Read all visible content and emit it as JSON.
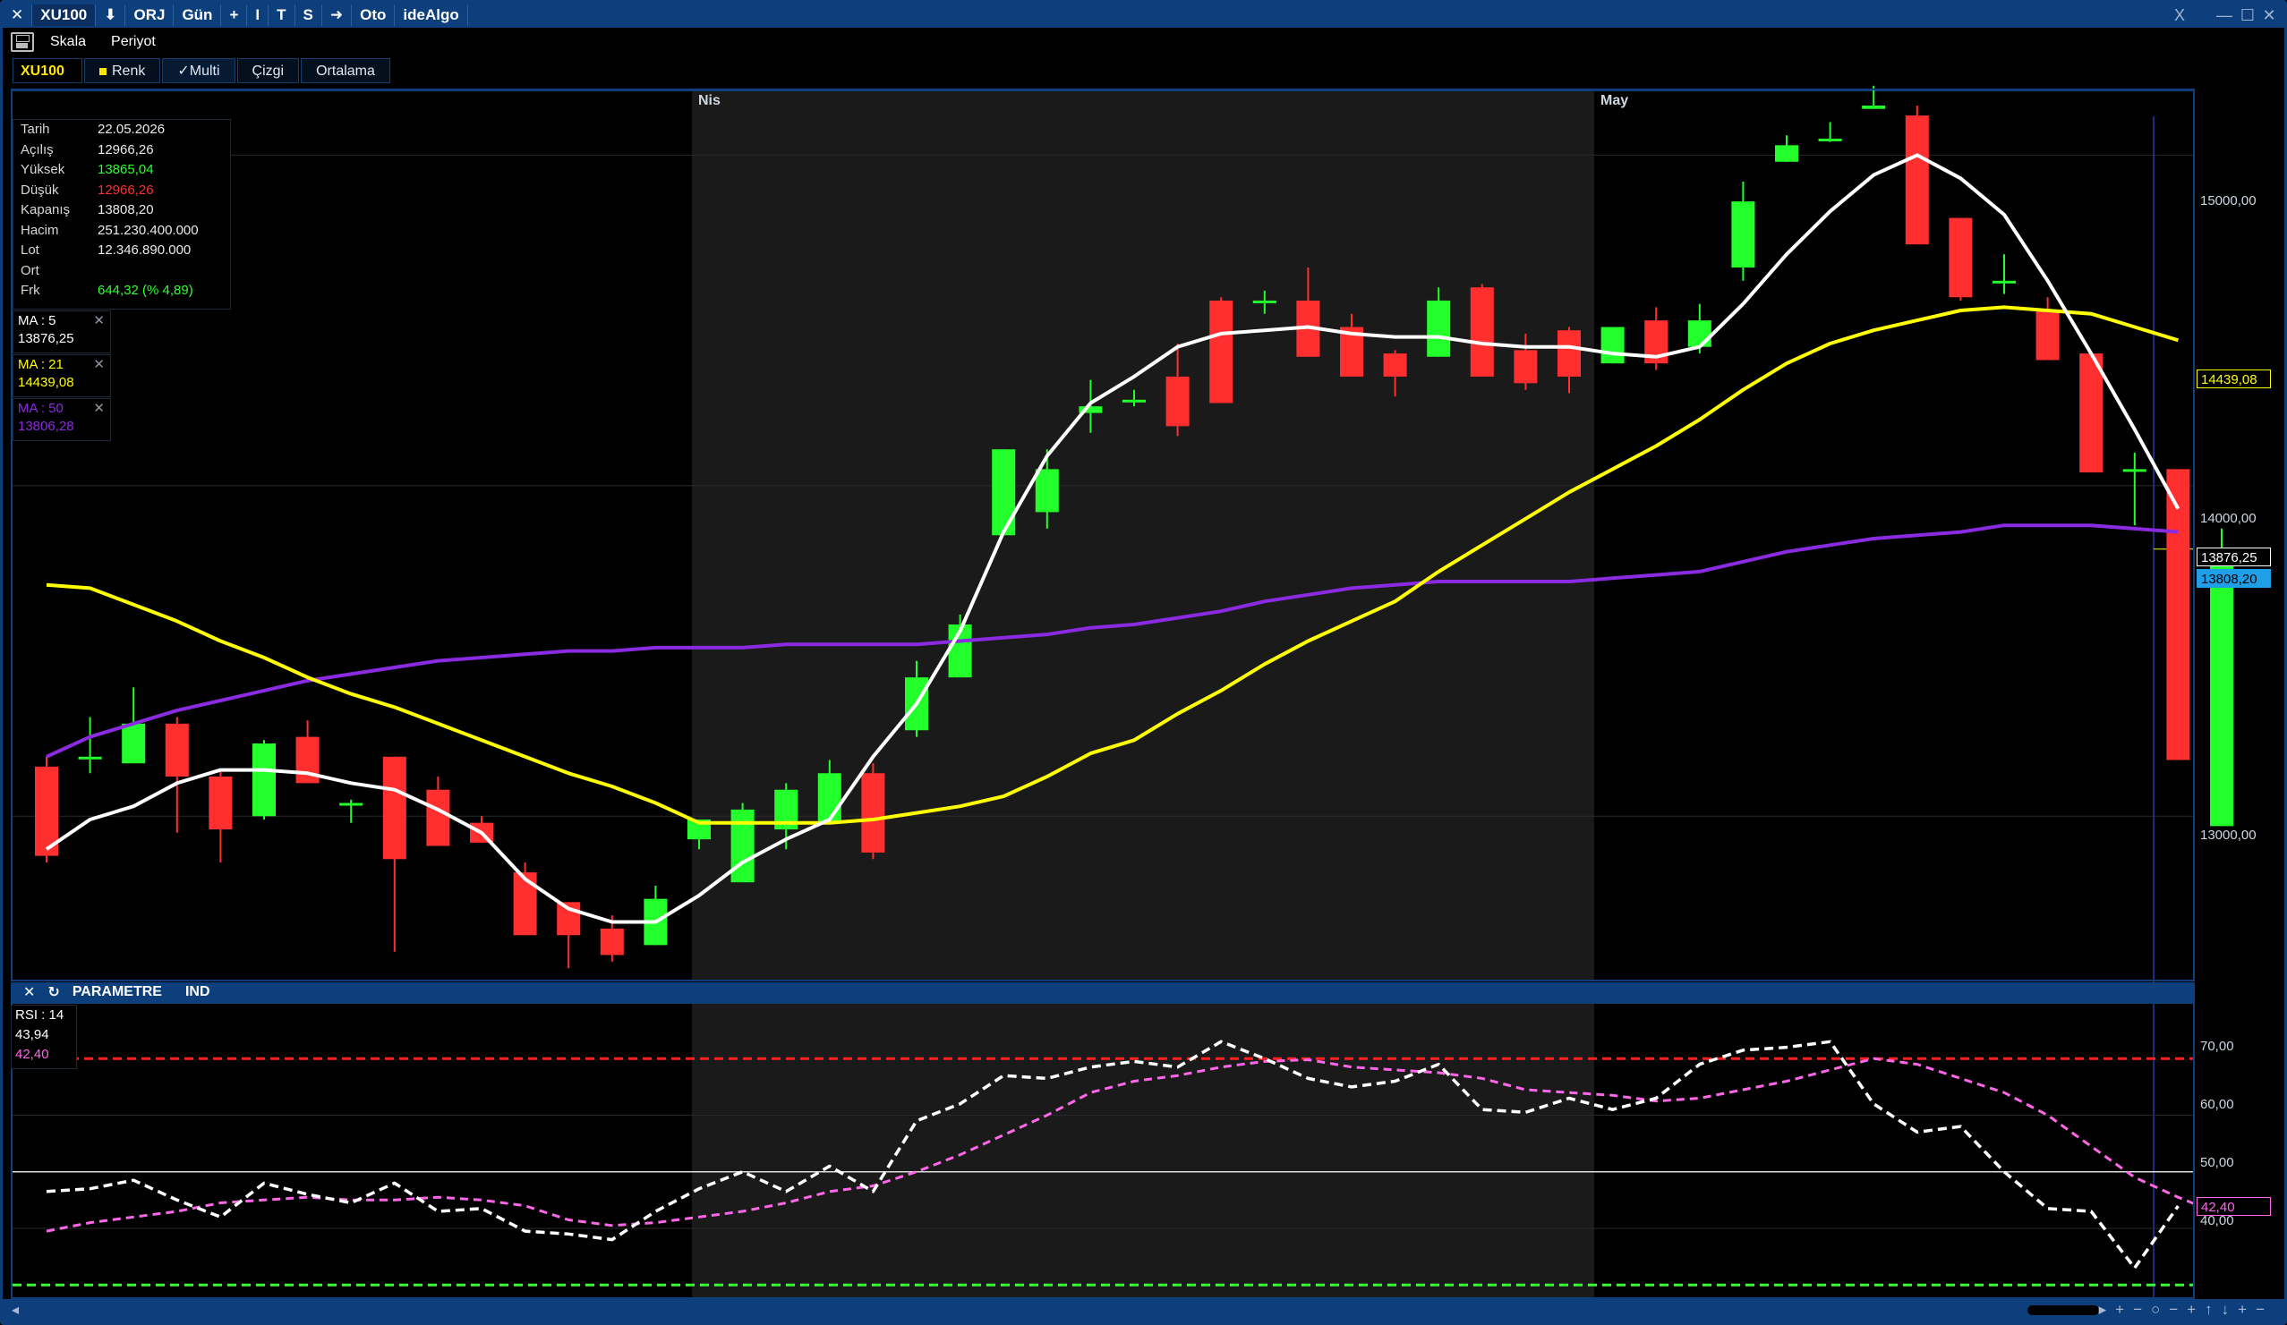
{
  "titlebar": {
    "items": [
      {
        "name": "close-icon",
        "label": "✕"
      },
      {
        "name": "symbol-label",
        "label": "XU100"
      },
      {
        "name": "download-icon",
        "label": "⬇"
      },
      {
        "name": "orj-button",
        "label": "ORJ"
      },
      {
        "name": "period-button",
        "label": "Gün"
      },
      {
        "name": "plus-icon",
        "label": "+"
      },
      {
        "name": "vertical-line-icon",
        "label": "I"
      },
      {
        "name": "t-button",
        "label": "T"
      },
      {
        "name": "s-button",
        "label": "S"
      },
      {
        "name": "arrow-right-icon",
        "label": "➜"
      },
      {
        "name": "oto-button",
        "label": "Oto"
      },
      {
        "name": "idealgo-button",
        "label": "ideAlgo"
      }
    ],
    "window_controls": [
      "X",
      "—",
      "☐",
      "✕"
    ]
  },
  "toolbar": {
    "scale": "Skala",
    "period": "Periyot"
  },
  "tabs": {
    "symbol": "XU100",
    "color": "Renk",
    "multi": "✓Multi",
    "line": "Çizgi",
    "average": "Ortalama"
  },
  "months": [
    "Nis",
    "May"
  ],
  "ohlc": [
    {
      "k": "Tarih",
      "v": "22.05.2026",
      "color": "#eaeaea"
    },
    {
      "k": "Açılış",
      "v": "12966,26",
      "color": "#eaeaea"
    },
    {
      "k": "Yüksek",
      "v": "13865,04",
      "color": "#2dff2d"
    },
    {
      "k": "Düşük",
      "v": "12966,26",
      "color": "#ff3030"
    },
    {
      "k": "Kapanış",
      "v": "13808,20",
      "color": "#eaeaea"
    },
    {
      "k": "Hacim",
      "v": "251.230.400.000",
      "color": "#eaeaea"
    },
    {
      "k": "Lot",
      "v": "12.346.890.000",
      "color": "#eaeaea"
    },
    {
      "k": "Ort",
      "v": "",
      "color": "#eaeaea"
    },
    {
      "k": "Frk",
      "v": "644,32 (% 4,89)",
      "color": "#2dff2d"
    }
  ],
  "ma": [
    {
      "label": "MA : 5",
      "value": "13876,25",
      "color": "#ffffff"
    },
    {
      "label": "MA : 21",
      "value": "14439,08",
      "color": "#ffff00"
    },
    {
      "label": "MA : 50",
      "value": "13806,28",
      "color": "#8a2be2"
    }
  ],
  "price_axis": [
    "15000,00",
    "14000,00",
    "13000,00"
  ],
  "price_tags": [
    {
      "value": "14439,08",
      "bg": "#000",
      "color": "#ffff00",
      "border": "#ffff00"
    },
    {
      "value": "13876,25",
      "bg": "#000",
      "color": "#ffffff",
      "border": "#ffffff"
    },
    {
      "value": "13808,20",
      "bg": "#1f9fe8",
      "color": "#000",
      "border": "#1f9fe8"
    }
  ],
  "indicator_bar": {
    "params": "PARAMETRE",
    "ind": "IND"
  },
  "rsi": {
    "label": "RSI : 14",
    "value": "43,94",
    "signal": "42,40"
  },
  "rsi_axis": [
    "70,00",
    "60,00",
    "50,00",
    "40,00"
  ],
  "rsi_tag": "42,40",
  "colors": {
    "up": "#23ff2a",
    "down": "#ff2f2f",
    "ma5": "#ffffff",
    "ma21": "#ffff00",
    "ma50": "#8a2be2",
    "rsi": "#ffffff",
    "rsi_signal": "#ff66e8",
    "brand": "#0d3f7d"
  },
  "chart_data": {
    "type": "candlestick",
    "y_range": [
      12500,
      15150
    ],
    "candles": [
      [
        13150,
        12880,
        13180,
        12860
      ],
      [
        13180,
        13180,
        13300,
        13130
      ],
      [
        13160,
        13280,
        13390,
        13160
      ],
      [
        13280,
        13120,
        13300,
        12950
      ],
      [
        13120,
        12960,
        13140,
        12860
      ],
      [
        13000,
        13220,
        13230,
        12990
      ],
      [
        13240,
        13100,
        13290,
        13100
      ],
      [
        13040,
        13040,
        13050,
        12980
      ],
      [
        13180,
        12870,
        13180,
        12590
      ],
      [
        13080,
        12910,
        13120,
        12910
      ],
      [
        12980,
        12920,
        13000,
        12920
      ],
      [
        12830,
        12640,
        12860,
        12640
      ],
      [
        12740,
        12640,
        12740,
        12540
      ],
      [
        12660,
        12580,
        12700,
        12560
      ],
      [
        12610,
        12750,
        12790,
        12610
      ],
      [
        12930,
        12990,
        12990,
        12900
      ],
      [
        12800,
        13020,
        13040,
        12800
      ],
      [
        12960,
        13080,
        13100,
        12900
      ],
      [
        12980,
        13130,
        13170,
        12980
      ],
      [
        13130,
        12890,
        13160,
        12870
      ],
      [
        13260,
        13420,
        13470,
        13240
      ],
      [
        13420,
        13580,
        13610,
        13420
      ],
      [
        13850,
        14110,
        14110,
        13850
      ],
      [
        13920,
        14050,
        14110,
        13870
      ],
      [
        14220,
        14240,
        14320,
        14160
      ],
      [
        14260,
        14260,
        14290,
        14240
      ],
      [
        14330,
        14180,
        14430,
        14150
      ],
      [
        14560,
        14250,
        14570,
        14250
      ],
      [
        14560,
        14560,
        14590,
        14520
      ],
      [
        14560,
        14390,
        14660,
        14390
      ],
      [
        14480,
        14330,
        14520,
        14330
      ],
      [
        14400,
        14330,
        14410,
        14270
      ],
      [
        14390,
        14560,
        14600,
        14390
      ],
      [
        14600,
        14330,
        14610,
        14330
      ],
      [
        14410,
        14310,
        14460,
        14290
      ],
      [
        14470,
        14330,
        14480,
        14280
      ],
      [
        14370,
        14480,
        14480,
        14370
      ],
      [
        14500,
        14370,
        14540,
        14350
      ],
      [
        14420,
        14500,
        14550,
        14400
      ],
      [
        14660,
        14860,
        14920,
        14620
      ],
      [
        14980,
        15030,
        15060,
        14980
      ],
      [
        15050,
        15050,
        15100,
        15040
      ],
      [
        15140,
        15150,
        15210,
        15140
      ],
      [
        15120,
        14730,
        15150,
        14730
      ],
      [
        14810,
        14570,
        14810,
        14560
      ],
      [
        14620,
        14620,
        14700,
        14580
      ],
      [
        14530,
        14380,
        14570,
        14380
      ],
      [
        14400,
        14040,
        14400,
        14040
      ],
      [
        14050,
        14050,
        14100,
        13880
      ],
      [
        14050,
        13170,
        14050,
        13170
      ],
      [
        12970,
        13810,
        13870,
        12970
      ]
    ],
    "ma5": [
      12900,
      12990,
      13030,
      13100,
      13140,
      13140,
      13130,
      13100,
      13080,
      13020,
      12950,
      12810,
      12720,
      12680,
      12680,
      12760,
      12860,
      12930,
      12990,
      13180,
      13340,
      13560,
      13860,
      14090,
      14250,
      14330,
      14420,
      14460,
      14470,
      14480,
      14460,
      14450,
      14450,
      14430,
      14420,
      14420,
      14400,
      14390,
      14420,
      14550,
      14700,
      14830,
      14940,
      15000,
      14930,
      14820,
      14620,
      14400,
      14170,
      13930
    ],
    "ma21": [
      13700,
      13690,
      13640,
      13590,
      13530,
      13480,
      13420,
      13370,
      13330,
      13280,
      13230,
      13180,
      13130,
      13090,
      13040,
      12980,
      12980,
      12980,
      12980,
      12990,
      13010,
      13030,
      13060,
      13120,
      13190,
      13230,
      13310,
      13380,
      13460,
      13530,
      13590,
      13650,
      13740,
      13820,
      13900,
      13980,
      14050,
      14120,
      14200,
      14290,
      14370,
      14430,
      14470,
      14500,
      14530,
      14540,
      14530,
      14520,
      14480,
      14440
    ],
    "ma50": [
      13180,
      13240,
      13280,
      13320,
      13350,
      13380,
      13410,
      13430,
      13450,
      13470,
      13480,
      13490,
      13500,
      13500,
      13510,
      13510,
      13510,
      13520,
      13520,
      13520,
      13520,
      13530,
      13540,
      13550,
      13570,
      13580,
      13600,
      13620,
      13650,
      13670,
      13690,
      13700,
      13710,
      13710,
      13710,
      13710,
      13720,
      13730,
      13740,
      13770,
      13800,
      13820,
      13840,
      13850,
      13860,
      13880,
      13880,
      13880,
      13870,
      13860
    ],
    "rsi": [
      46.5,
      47,
      48.5,
      45,
      42,
      48,
      46,
      44.5,
      48,
      43,
      43.5,
      39.5,
      39,
      38,
      43,
      47,
      50,
      46.5,
      51,
      46.5,
      59,
      62,
      67,
      66.5,
      68.5,
      69.5,
      68.5,
      73,
      70,
      66.5,
      65,
      66,
      69,
      61,
      60.5,
      63,
      61,
      63,
      69,
      71.5,
      72,
      73,
      62,
      57,
      58,
      50,
      43.5,
      43,
      33,
      43.94
    ],
    "rsi_signal": [
      39.5,
      41,
      42,
      43,
      44.5,
      45,
      45.5,
      45,
      45,
      45.5,
      45,
      44,
      41.5,
      40.5,
      41,
      42,
      43,
      44.5,
      46.5,
      47.5,
      50,
      53,
      56.5,
      60,
      64,
      66,
      67,
      68.5,
      69.5,
      69.8,
      68.5,
      68,
      67.5,
      66.5,
      64.5,
      64,
      63.5,
      62.5,
      63,
      64.5,
      66,
      68,
      70,
      69,
      66.5,
      64,
      60,
      54.5,
      49,
      45.5,
      42.4
    ]
  }
}
